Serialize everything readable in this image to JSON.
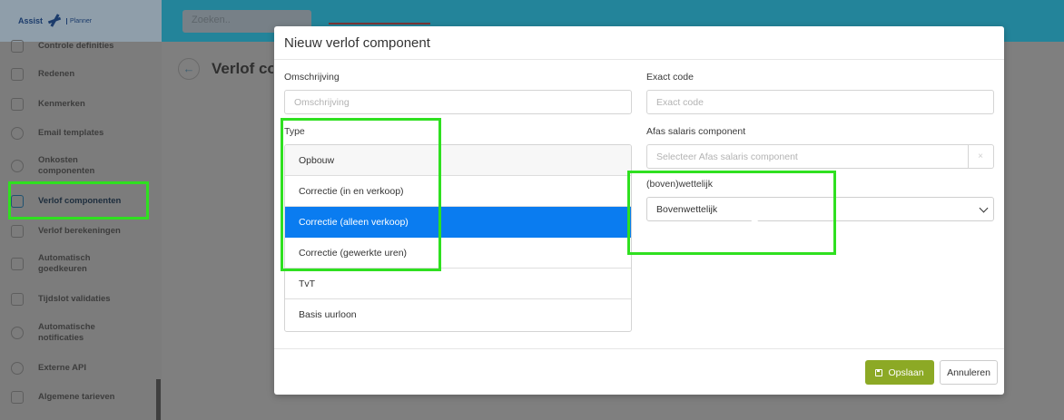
{
  "app": {
    "logo_text": "Assist",
    "logo_sub": "Planner",
    "search_placeholder": "Zoeken.."
  },
  "sidebar": {
    "items": [
      {
        "label": "Controle definities",
        "icon": "checklist-icon"
      },
      {
        "label": "Redenen",
        "icon": "chat-icon"
      },
      {
        "label": "Kenmerken",
        "icon": "tag-icon"
      },
      {
        "label": "Email templates",
        "icon": "at-sign-icon"
      },
      {
        "label": "Onkosten componenten",
        "icon": "bicycle-icon"
      },
      {
        "label": "Verlof componenten",
        "icon": "suitcase-icon",
        "active": true
      },
      {
        "label": "Verlof berekeningen",
        "icon": "calculator-icon"
      },
      {
        "label": "Automatisch goedkeuren",
        "icon": "thumbs-up-icon"
      },
      {
        "label": "Tijdslot validaties",
        "icon": "checkbox-icon"
      },
      {
        "label": "Automatische notificaties",
        "icon": "bell-icon"
      },
      {
        "label": "Externe API",
        "icon": "plug-icon"
      },
      {
        "label": "Algemene tarieven",
        "icon": "document-icon"
      }
    ]
  },
  "page": {
    "title": "Verlof componenten",
    "back_icon": "arrow-left-icon"
  },
  "modal": {
    "title": "Nieuw verlof component",
    "omschrijving": {
      "label": "Omschrijving",
      "placeholder": "Omschrijving",
      "value": ""
    },
    "exact_code": {
      "label": "Exact code",
      "placeholder": "Exact code",
      "value": ""
    },
    "type": {
      "label": "Type",
      "options": [
        "Opbouw",
        "Correctie (in en verkoop)",
        "Correctie (alleen verkoop)",
        "Correctie (gewerkte uren)",
        "TvT",
        "Basis uurloon"
      ],
      "selected": "Correctie (alleen verkoop)"
    },
    "afas": {
      "label": "Afas salaris component",
      "placeholder": "Selecteer Afas salaris component",
      "clear_glyph": "×"
    },
    "wettelijk": {
      "label": "(boven)wettelijk",
      "value": "Bovenwettelijk"
    },
    "buttons": {
      "save": "Opslaan",
      "cancel": "Annuleren"
    }
  },
  "colors": {
    "topbar": "#23849a",
    "selected": "#0a7cf0",
    "save_button": "#8ca925",
    "highlight": "#2fe020"
  }
}
